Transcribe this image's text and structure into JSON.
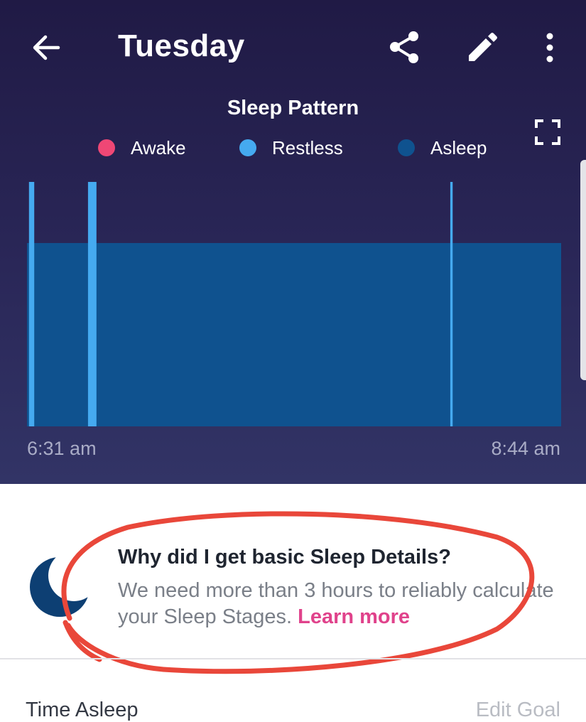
{
  "header": {
    "title": "Tuesday",
    "icons": [
      "back-arrow-icon",
      "share-icon",
      "edit-pencil-icon",
      "more-vertical-icon",
      "fullscreen-icon"
    ]
  },
  "chart_data": {
    "type": "bar",
    "title": "Sleep Pattern",
    "legend": [
      {
        "name": "Awake",
        "color": "#ef4775"
      },
      {
        "name": "Restless",
        "color": "#45aaf0"
      },
      {
        "name": "Asleep",
        "color": "#0f528f"
      }
    ],
    "x_start": "6:31 am",
    "x_end": "8:44 am",
    "duration_min": 133,
    "levels": {
      "Asleep": 1,
      "Restless": 2,
      "Awake": 3
    },
    "segments": [
      {
        "state": "Asleep",
        "start_min": 0,
        "end_min": 133
      },
      {
        "state": "Restless",
        "start_min": 0.5,
        "end_min": 1.8
      },
      {
        "state": "Restless",
        "start_min": 15.2,
        "end_min": 17.3
      },
      {
        "state": "Restless",
        "start_min": 105.4,
        "end_min": 106.0
      }
    ]
  },
  "info": {
    "title": "Why did I get basic Sleep Details?",
    "text": "We need more than 3 hours to reliably calculate your Sleep Stages.",
    "link": "Learn more"
  },
  "footer": {
    "label": "Time Asleep",
    "action": "Edit Goal"
  },
  "colors": {
    "header_bg": "#231d4a",
    "awake": "#ef4775",
    "restless": "#45aaf0",
    "asleep": "#0f528f",
    "link": "#e0428b",
    "annotation": "#e9473a"
  }
}
